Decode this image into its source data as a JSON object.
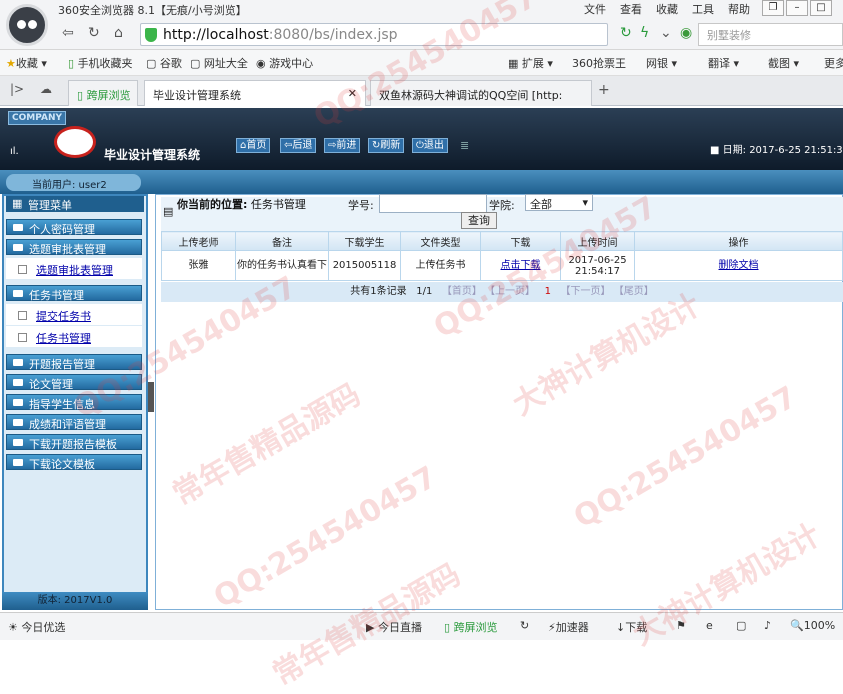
{
  "browser": {
    "title": "360安全浏览器 8.1【无痕/小号浏览】",
    "menu": [
      "文件",
      "查看",
      "收藏",
      "工具",
      "帮助"
    ],
    "address": "http://localhost:8080/bs/index.jsp",
    "address_host": "http://localhost",
    "address_rest": ":8080/bs/index.jsp",
    "search_placeholder": "别墅装修",
    "bookmarks": [
      "收藏",
      "手机收藏夹",
      "谷歌",
      "网址大全",
      "游戏中心",
      "扩展",
      "360抢票王",
      "网银",
      "翻译",
      "截图",
      "更多"
    ],
    "tabs": [
      "跨屏浏览",
      "毕业设计管理系统",
      "双鱼林源码大神调试的QQ空间 [http:"
    ],
    "status": [
      "今日优选",
      "今日直播",
      "跨屏浏览",
      "加速器",
      "下载",
      "100%"
    ]
  },
  "app": {
    "company": "COMPANY",
    "title": "毕业设计管理系统",
    "nav": [
      "首页",
      "后退",
      "前进",
      "刷新",
      "退出"
    ],
    "date_label": "日期: 2017-6-25 21:51:3",
    "current_user": "当前用户: user2",
    "menu_title": "管理菜单",
    "version": "版本: 2017V1.0",
    "sidebar": [
      {
        "label": "个人密码管理"
      },
      {
        "label": "选题审批表管理",
        "sub": [
          "选题审批表管理"
        ]
      },
      {
        "label": "任务书管理",
        "sub": [
          "提交任务书",
          "任务书管理"
        ]
      },
      {
        "label": "开题报告管理"
      },
      {
        "label": "论文管理"
      },
      {
        "label": "指导学生信息"
      },
      {
        "label": "成绩和评语管理"
      },
      {
        "label": "下载开题报告模板"
      },
      {
        "label": "下载论文模板"
      }
    ]
  },
  "main": {
    "location_label": "你当前的位置:",
    "location_value": "任务书管理",
    "student_no_label": "学号:",
    "student_no_value": "",
    "college_label": "学院:",
    "college_value": "全部",
    "query_button": "查询",
    "columns": [
      "上传老师",
      "备注",
      "下载学生",
      "文件类型",
      "下载",
      "上传时间",
      "操作"
    ],
    "rows": [
      [
        "张雅",
        "你的任务书认真看下",
        "2015005118",
        "上传任务书",
        "点击下载",
        "2017-06-25 21:54:17",
        "删除文档"
      ]
    ],
    "pager": {
      "summary": "共有1条记录",
      "page": "1/1",
      "first": "【首页】",
      "prev": "【上一页】",
      "current": "1",
      "next": "【下一页】",
      "last": "【尾页】"
    }
  },
  "watermarks": [
    "QQ:254540457",
    "大神计算机设计",
    "常年售精品源码"
  ],
  "colors": {
    "header_dark": "#0e1b2a",
    "sidebar_blue": "#236aa0",
    "link": "#0000aa",
    "watermark": "#dc3c3c"
  }
}
